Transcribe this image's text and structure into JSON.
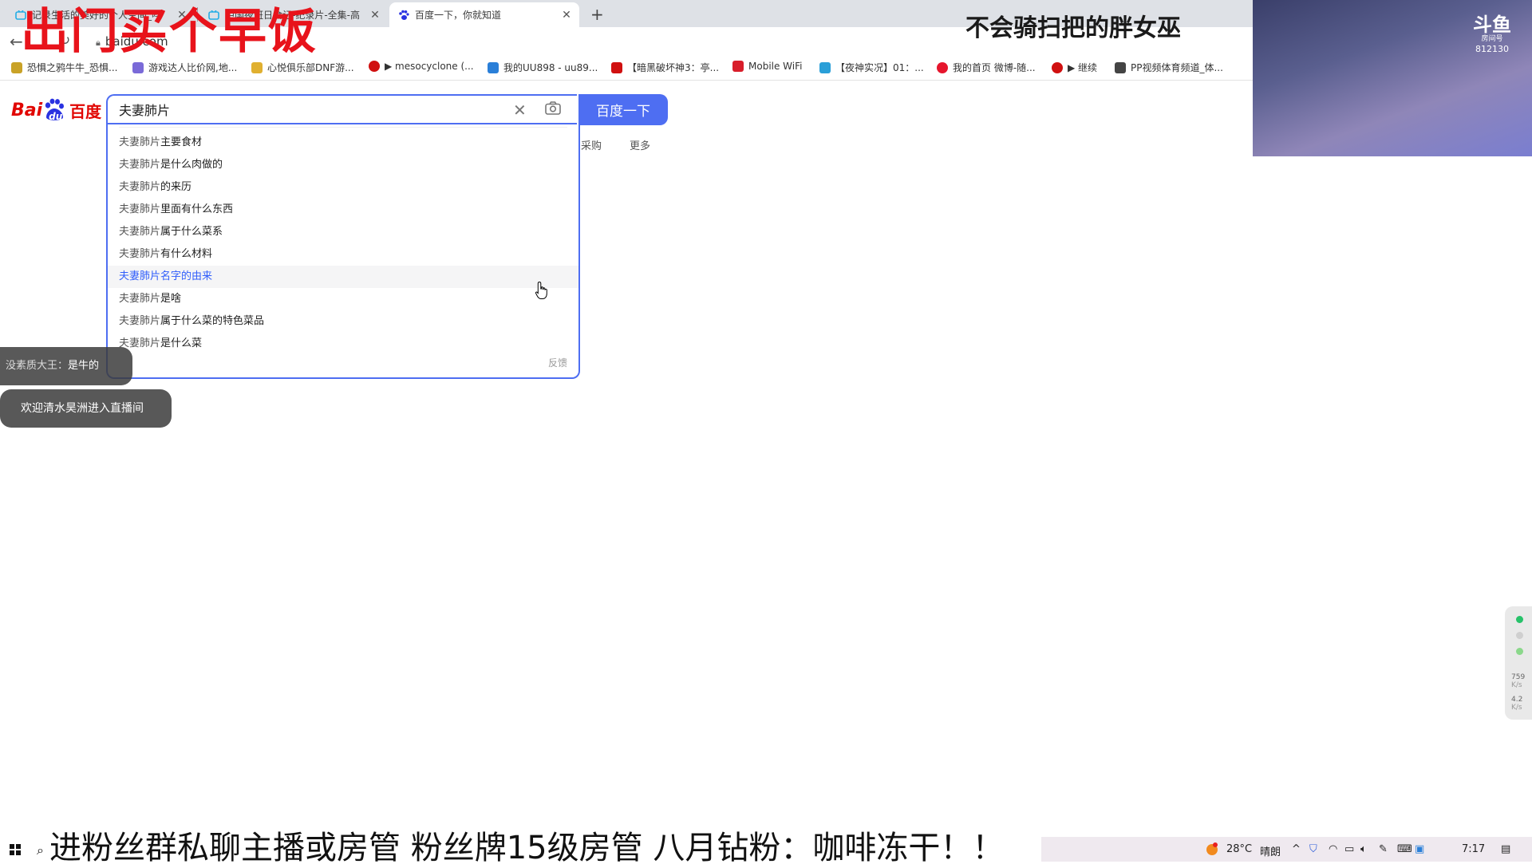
{
  "browser": {
    "tabs": [
      {
        "title": "记录生活的美好的个人空间_哔",
        "active": false
      },
      {
        "title": "中国夜班日食记-纪录片-全集-高",
        "active": false
      },
      {
        "title": "百度一下，你就知道",
        "active": true
      }
    ],
    "url": "baidu.com",
    "bookmarks": [
      {
        "label": "恐惧之鸦牛牛_恐惧...",
        "color": "#c9a227"
      },
      {
        "label": "游戏达人比价网,地...",
        "color": "#7a6ad8"
      },
      {
        "label": "心悦俱乐部DNF游...",
        "color": "#e0b030"
      },
      {
        "label": "▶ mesocyclone (...",
        "color": "#d01010"
      },
      {
        "label": "我的UU898 - uu89...",
        "color": "#2a7fd8"
      },
      {
        "label": "【暗黑破坏神3：亭...",
        "color": "#d01010"
      },
      {
        "label": "Mobile WiFi",
        "color": "#d81e2a"
      },
      {
        "label": "【夜神实况】01：...",
        "color": "#2a9fd8"
      },
      {
        "label": "我的首页 微博-随...",
        "color": "#e6162d"
      },
      {
        "label": "▶ 继续",
        "color": "#d01010"
      },
      {
        "label": "PP视频体育频道_体...",
        "color": "#444444"
      }
    ]
  },
  "baidu": {
    "logo_bai": "Bai",
    "logo_du": "du",
    "logo_cn": "百度",
    "query": "夫妻肺片",
    "search_button": "百度一下",
    "nav_partial_1": "采购",
    "nav_partial_2": "更多",
    "suggestions": [
      {
        "q": "夫妻肺片",
        "rest": "主要食材"
      },
      {
        "q": "夫妻肺片",
        "rest": "是什么肉做的"
      },
      {
        "q": "夫妻肺片",
        "rest": "的来历"
      },
      {
        "q": "夫妻肺片",
        "rest": "里面有什么东西"
      },
      {
        "q": "夫妻肺片",
        "rest": "属于什么菜系"
      },
      {
        "q": "夫妻肺片",
        "rest": "有什么材料"
      },
      {
        "q": "夫妻肺片",
        "rest": "名字的由来"
      },
      {
        "q": "夫妻肺片",
        "rest": "是啥"
      },
      {
        "q": "夫妻肺片",
        "rest": "属于什么菜的特色菜品"
      },
      {
        "q": "夫妻肺片",
        "rest": "是什么菜"
      }
    ],
    "feedback": "反馈",
    "accent": "#4e6ef2"
  },
  "stream": {
    "overlay_title": "出门买个早饭",
    "streamer_name": "不会骑扫把的胖女巫",
    "platform_logo": "斗鱼",
    "platform_sub": "房间号",
    "room_number": "812130",
    "chat_user": "没素质大王：",
    "chat_message": "是牛的",
    "welcome_text": "欢迎清水昊洲进入直播间",
    "ticker": "进粉丝群私聊主播或房管 粉丝牌15级房管 八月钻粉：咖啡冻干！！",
    "speed_up": "759",
    "speed_down": "4.2",
    "speed_unit": "K/s"
  },
  "taskbar": {
    "temperature": "28°C",
    "weather": "晴朗",
    "time": "7:17"
  }
}
